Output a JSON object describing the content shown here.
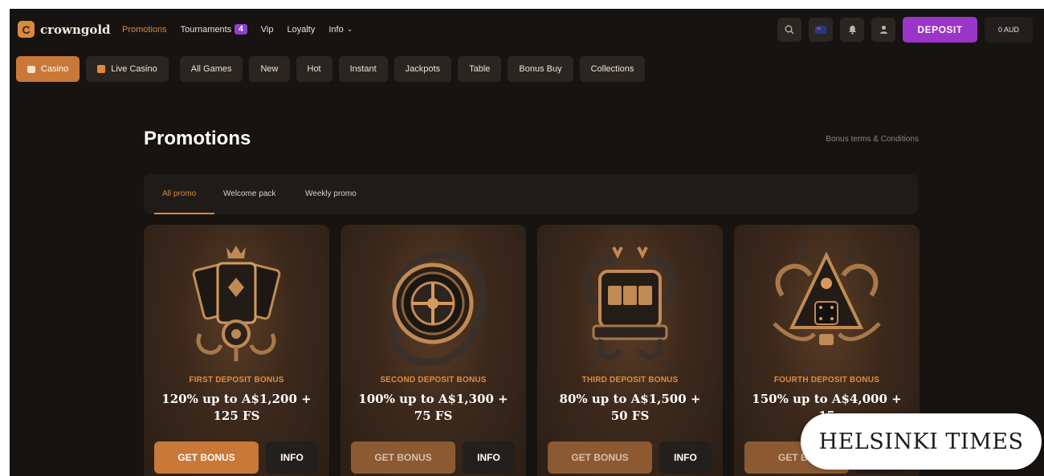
{
  "brand": {
    "name": "crowngold",
    "logo_icon": "crown-c-icon"
  },
  "nav": {
    "links": [
      {
        "label": "Promotions",
        "active": true
      },
      {
        "label": "Tournaments",
        "badge": "4"
      },
      {
        "label": "Vip"
      },
      {
        "label": "Loyalty"
      },
      {
        "label": "Info",
        "chevron": "⌄"
      }
    ]
  },
  "header_actions": {
    "icons": [
      "search-icon",
      "flag-icon",
      "bell-icon",
      "user-icon"
    ],
    "deposit_label": "DEPOSIT",
    "balance": "0 AUD"
  },
  "categories": [
    {
      "label": "Casino",
      "active": true,
      "icon": "casino-icon"
    },
    {
      "label": "Live Casino",
      "icon": "live-casino-icon"
    },
    {
      "label": "All Games"
    },
    {
      "label": "New"
    },
    {
      "label": "Hot"
    },
    {
      "label": "Instant"
    },
    {
      "label": "Jackpots"
    },
    {
      "label": "Table"
    },
    {
      "label": "Bonus Buy"
    },
    {
      "label": "Collections"
    }
  ],
  "page": {
    "title": "Promotions",
    "terms_link": "Bonus terms & Conditions",
    "tabs": [
      {
        "label": "All promo",
        "active": true
      },
      {
        "label": "Welcome pack"
      },
      {
        "label": "Weekly promo"
      }
    ]
  },
  "promos": [
    {
      "label": "FIRST DEPOSIT BONUS",
      "offer_line1": "120% up to A$1,200 +",
      "offer_line2": "125 FS",
      "get_label": "GET BONUS",
      "info_label": "INFO",
      "art": "cards-crown-icon"
    },
    {
      "label": "SECOND DEPOSIT BONUS",
      "offer_line1": "100% up to A$1,300 +",
      "offer_line2": "75 FS",
      "get_label": "GET BONUS",
      "info_label": "INFO",
      "art": "roulette-wheel-icon"
    },
    {
      "label": "THIRD DEPOSIT BONUS",
      "offer_line1": "80% up to A$1,500 +",
      "offer_line2": "50 FS",
      "get_label": "GET BONUS",
      "info_label": "INFO",
      "art": "slot-machine-icon"
    },
    {
      "label": "FOURTH DEPOSIT BONUS",
      "offer_line1": "150% up to A$4,000 +",
      "offer_line2": "15",
      "get_label": "GET BO",
      "info_label": "",
      "art": "dice-pyramid-icon"
    }
  ],
  "watermark": "HELSINKI TIMES",
  "colors": {
    "accent": "#d98a3d",
    "deposit": "#9b35c9",
    "background": "#161310",
    "card": "#3b281b"
  }
}
